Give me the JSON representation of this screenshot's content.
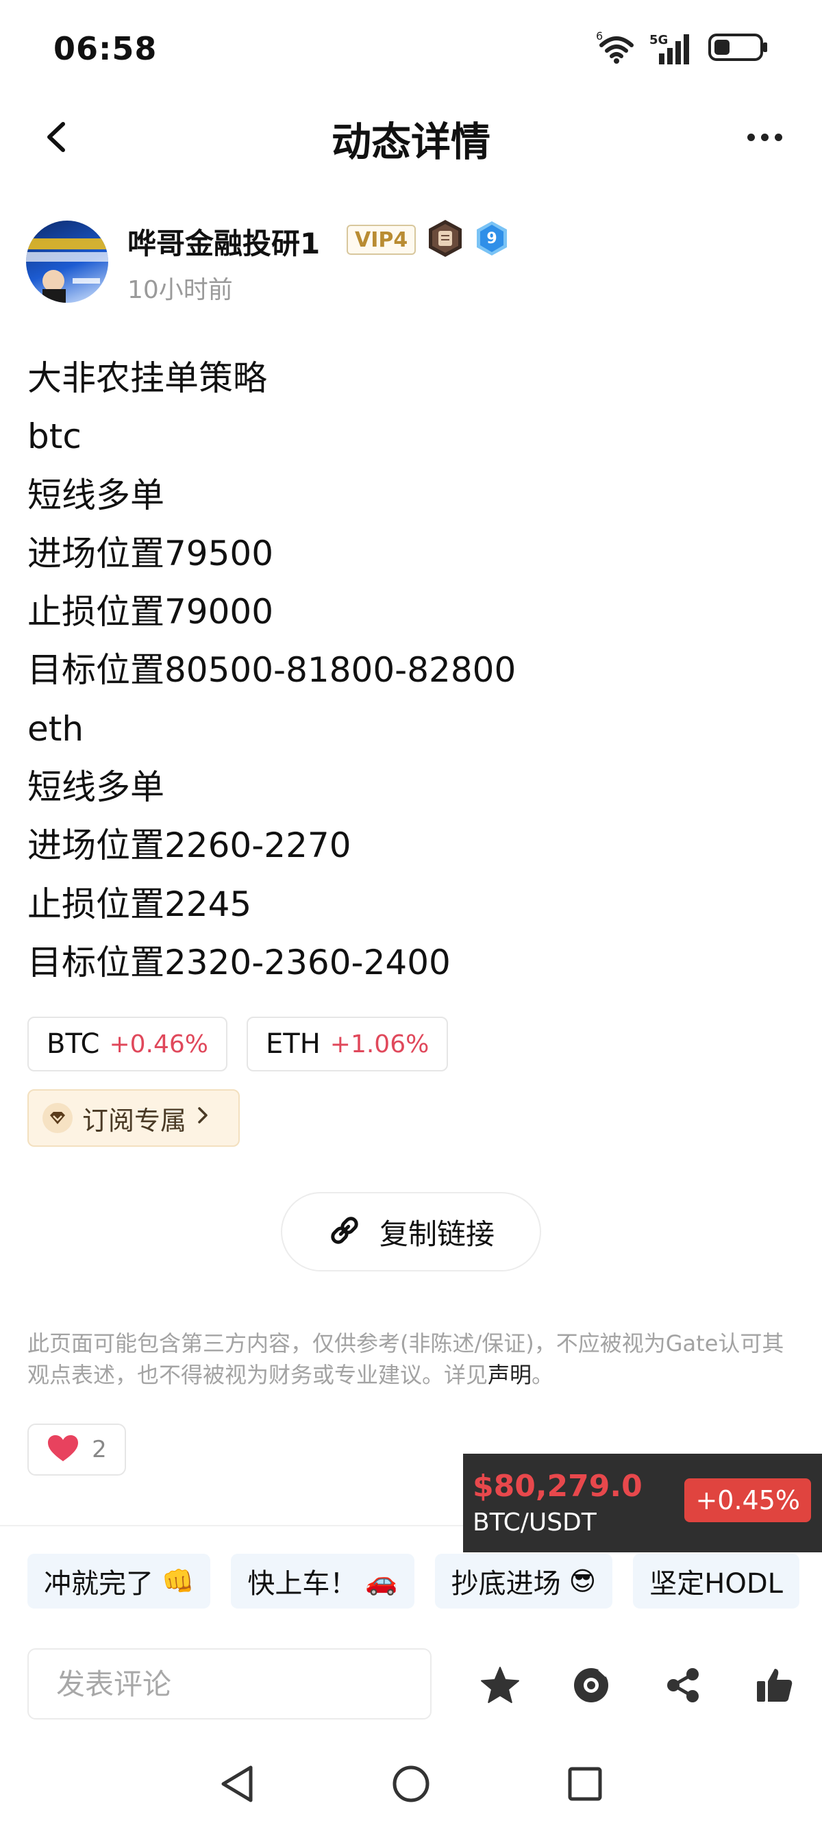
{
  "status_bar": {
    "time": "06:58",
    "wifi_badge": "6",
    "network": "5G",
    "battery_level": 0.35
  },
  "header": {
    "title": "动态详情"
  },
  "author": {
    "name": "哗哥金融投研1",
    "vip": "VIP4",
    "level": "9",
    "time": "10小时前"
  },
  "post": {
    "lines": [
      "大非农挂单策略",
      "btc",
      "短线多单",
      "进场位置79500",
      "止损位置79000",
      "目标位置80500-81800-82800",
      "eth",
      "短线多单",
      "进场位置2260-2270",
      "止损位置2245",
      "目标位置2320-2360-2400"
    ]
  },
  "coins": [
    {
      "symbol": "BTC",
      "change": "+0.46%"
    },
    {
      "symbol": "ETH",
      "change": "+1.06%"
    }
  ],
  "subscribe": {
    "label": "订阅专属"
  },
  "copy_link": {
    "label": "复制链接"
  },
  "disclaimer": {
    "text": "此页面可能包含第三方内容，仅供参考(非陈述/保证)，不应被视为Gate认可其观点表述，也不得被视为财务或专业建议。详见",
    "link": "声明",
    "end": "。"
  },
  "like": {
    "count": "2"
  },
  "ticker": {
    "price": "$80,279.0",
    "pair": "BTC/USDT",
    "change": "+0.45%"
  },
  "quick_replies": [
    {
      "label": "冲就完了",
      "emoji": "👊"
    },
    {
      "label": "快上车！",
      "emoji": "🚗"
    },
    {
      "label": "抄底进场",
      "emoji": "😎"
    },
    {
      "label": "坚定HODL",
      "emoji": ""
    }
  ],
  "comment": {
    "placeholder": "发表评论"
  },
  "colors": {
    "up": "#e0485b",
    "ticker_bg": "#2f2f2f",
    "chip_bg": "#f0f6fc"
  }
}
